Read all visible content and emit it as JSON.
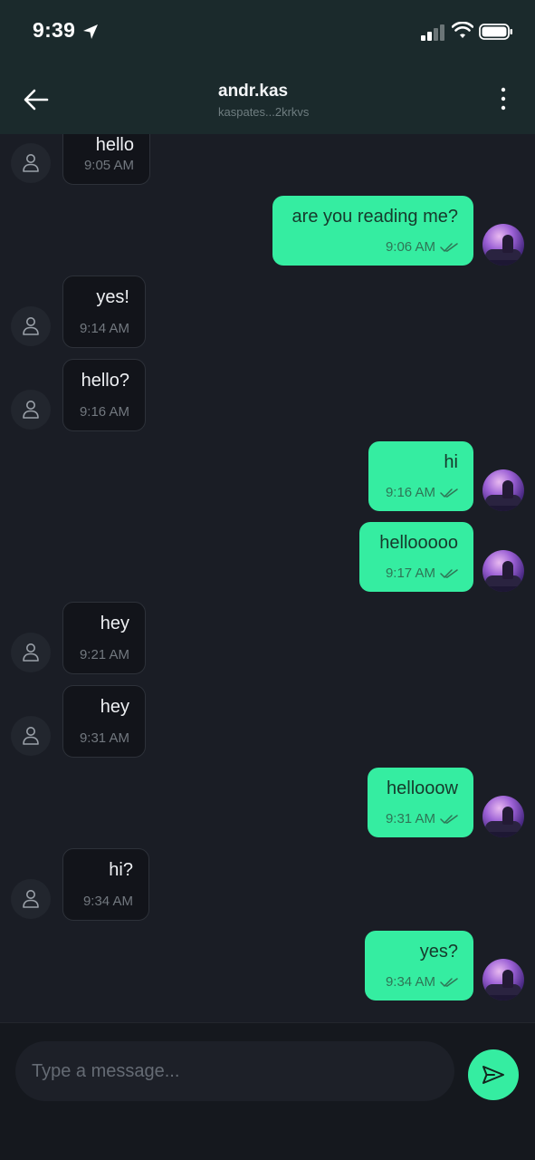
{
  "status_bar": {
    "time": "9:39",
    "icons": [
      "location-arrow-icon",
      "cellular-signal-icon",
      "wifi-icon",
      "battery-icon"
    ]
  },
  "header": {
    "back_icon": "arrow-left-icon",
    "contact_name": "andr.kas",
    "contact_address": "kaspates...2krkvs",
    "more_icon": "more-vertical-icon"
  },
  "colors": {
    "background": "#1a1d25",
    "header_bg": "#1b2a2c",
    "outgoing_bubble": "#35eda1",
    "incoming_bubble": "#12141a",
    "accent": "#35eda1"
  },
  "messages": [
    {
      "direction": "in",
      "text": "hello",
      "time": "9:05 AM"
    },
    {
      "direction": "out",
      "text": "are you reading me?",
      "time": "9:06 AM",
      "status": "read"
    },
    {
      "direction": "in",
      "text": "yes!",
      "time": "9:14 AM"
    },
    {
      "direction": "in",
      "text": "hello?",
      "time": "9:16 AM"
    },
    {
      "direction": "out",
      "text": "hi",
      "time": "9:16 AM",
      "status": "read"
    },
    {
      "direction": "out",
      "text": "hellooooo",
      "time": "9:17 AM",
      "status": "read"
    },
    {
      "direction": "in",
      "text": "hey",
      "time": "9:21 AM"
    },
    {
      "direction": "in",
      "text": "hey",
      "time": "9:31 AM"
    },
    {
      "direction": "out",
      "text": "hellooow",
      "time": "9:31 AM",
      "status": "read"
    },
    {
      "direction": "in",
      "text": "hi?",
      "time": "9:34 AM"
    },
    {
      "direction": "out",
      "text": "yes?",
      "time": "9:34 AM",
      "status": "read"
    }
  ],
  "composer": {
    "placeholder": "Type a message...",
    "value": "",
    "send_icon": "send-icon"
  }
}
